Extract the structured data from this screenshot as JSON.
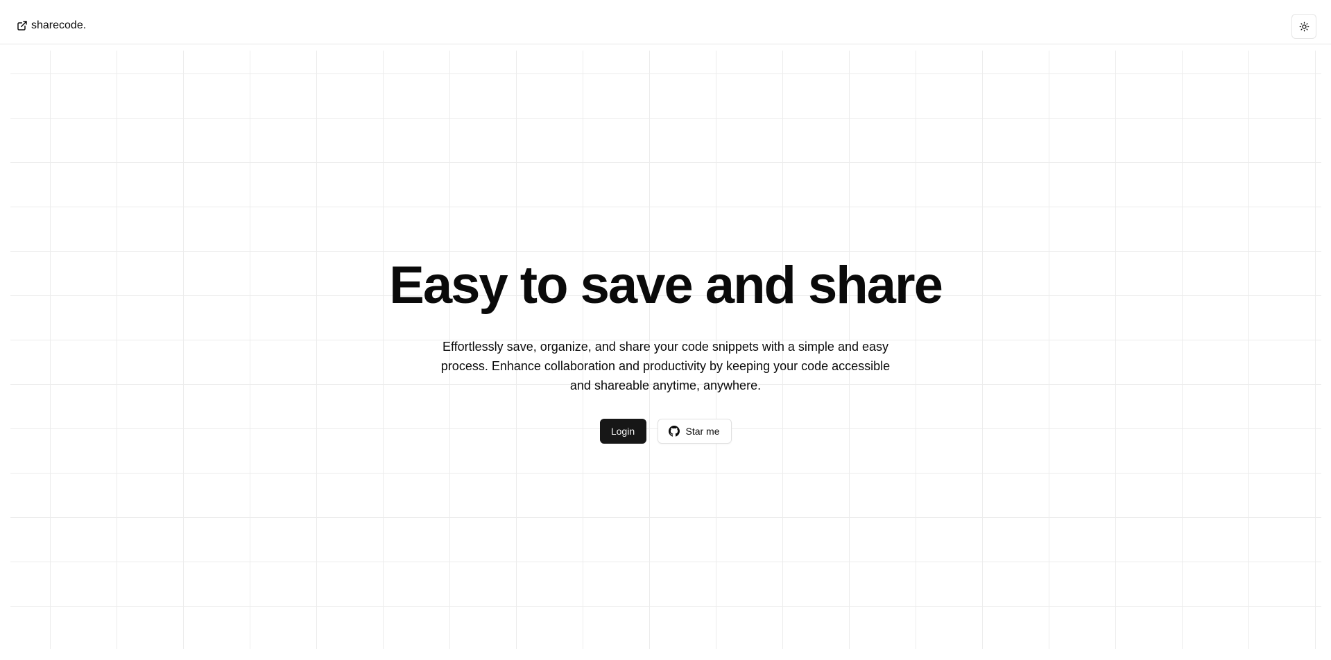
{
  "header": {
    "brand_label": "sharecode.",
    "brand_icon": "external-link-icon",
    "theme_toggle_icon": "sun-icon"
  },
  "hero": {
    "title": "Easy to save and share",
    "description": "Effortlessly save, organize, and share your code snippets with a simple and easy process. Enhance collaboration and productivity by keeping your code accessible and shareable anytime, anywhere.",
    "login_label": "Login",
    "star_label": "Star me",
    "star_icon": "github-icon"
  },
  "colors": {
    "primary_button_bg": "#171717",
    "grid_line": "#ececec",
    "border": "#e5e5e5"
  }
}
